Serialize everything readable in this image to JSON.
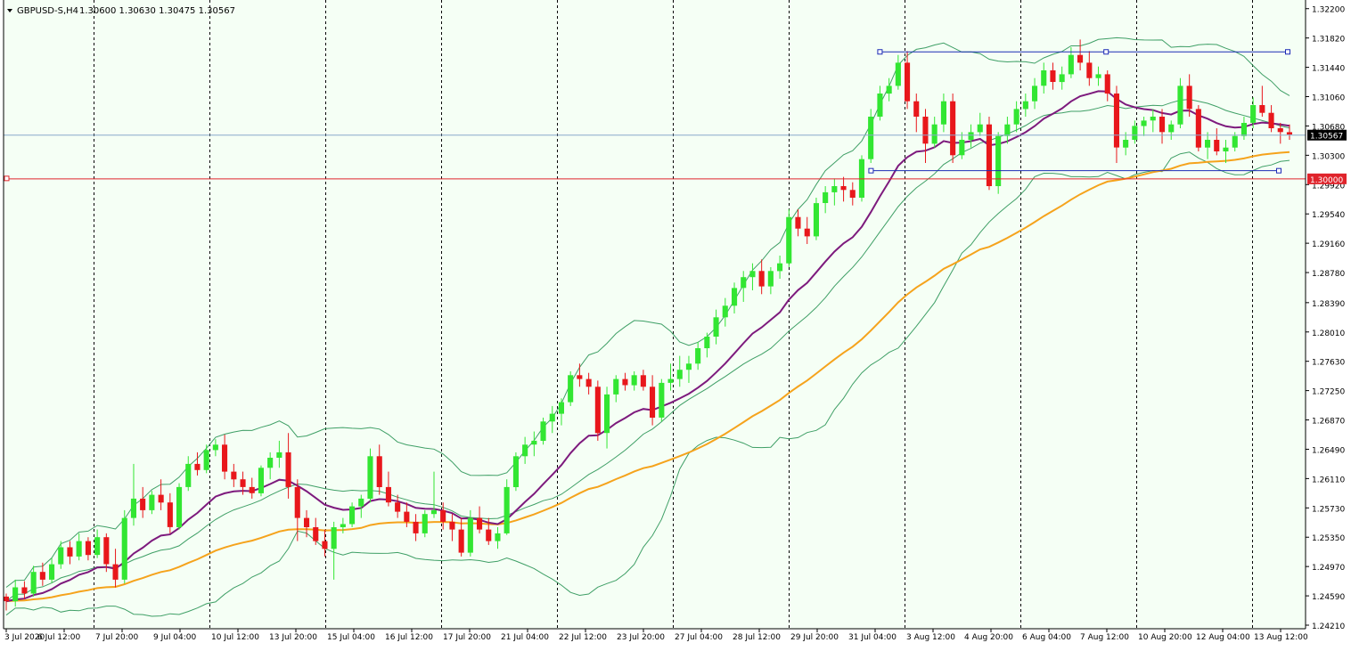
{
  "header": {
    "symbol": "GBPUSD-S,H4",
    "ohlc": "1.30600 1.30630 1.30475 1.30567"
  },
  "colors": {
    "background": "#f5fff5",
    "bull_candle": "#32e632",
    "bear_candle": "#e8171b",
    "ma_fast": "#7d1a7d",
    "ma_slow": "#f5a31c",
    "bollinger": "#3f9f66",
    "box_lines": "#1c2bb5",
    "level_line": "#e0242c",
    "current_price_line": "#8aa8cc"
  },
  "chart_data": {
    "type": "candlestick",
    "timeframe": "H4",
    "ylim": [
      1.2421,
      1.3222
    ],
    "price_axis_ticks": [
      "1.32200",
      "1.31820",
      "1.31440",
      "1.31060",
      "1.30680",
      "1.30300",
      "1.29920",
      "1.29540",
      "1.29160",
      "1.28780",
      "1.28390",
      "1.28010",
      "1.27630",
      "1.27250",
      "1.26870",
      "1.26490",
      "1.26110",
      "1.25730",
      "1.25350",
      "1.24970",
      "1.24590",
      "1.24210"
    ],
    "time_axis_labels": [
      "3 Jul 2020",
      "6 Jul 12:00",
      "7 Jul 20:00",
      "9 Jul 04:00",
      "10 Jul 12:00",
      "13 Jul 20:00",
      "15 Jul 04:00",
      "16 Jul 12:00",
      "17 Jul 20:00",
      "21 Jul 04:00",
      "22 Jul 12:00",
      "23 Jul 20:00",
      "27 Jul 04:00",
      "28 Jul 12:00",
      "29 Jul 20:00",
      "31 Jul 04:00",
      "3 Aug 12:00",
      "4 Aug 20:00",
      "6 Aug 04:00",
      "7 Aug 12:00",
      "10 Aug 20:00",
      "12 Aug 04:00",
      "13 Aug 12:00"
    ],
    "current_price_label": "1.30567",
    "level_label": "1.30000",
    "current_price": 1.30567,
    "level_price": 1.3,
    "range_box": {
      "high": 1.3164,
      "low": 1.301
    },
    "candles": [
      [
        1.2458,
        1.2462,
        1.244,
        1.2452
      ],
      [
        1.2452,
        1.248,
        1.2445,
        1.247
      ],
      [
        1.247,
        1.2478,
        1.2455,
        1.2462
      ],
      [
        1.2462,
        1.2498,
        1.2458,
        1.249
      ],
      [
        1.249,
        1.2502,
        1.2472,
        1.248
      ],
      [
        1.248,
        1.2508,
        1.2476,
        1.25
      ],
      [
        1.25,
        1.253,
        1.2494,
        1.2522
      ],
      [
        1.2522,
        1.253,
        1.25,
        1.251
      ],
      [
        1.251,
        1.254,
        1.2505,
        1.253
      ],
      [
        1.253,
        1.2535,
        1.2505,
        1.2512
      ],
      [
        1.2512,
        1.2545,
        1.2508,
        1.2535
      ],
      [
        1.2535,
        1.254,
        1.249,
        1.25
      ],
      [
        1.25,
        1.252,
        1.247,
        1.248
      ],
      [
        1.248,
        1.257,
        1.2475,
        1.256
      ],
      [
        1.256,
        1.263,
        1.255,
        1.2585
      ],
      [
        1.2585,
        1.26,
        1.256,
        1.257
      ],
      [
        1.257,
        1.2595,
        1.2565,
        1.259
      ],
      [
        1.259,
        1.261,
        1.257,
        1.258
      ],
      [
        1.258,
        1.2592,
        1.254,
        1.2548
      ],
      [
        1.2548,
        1.2605,
        1.2545,
        1.26
      ],
      [
        1.26,
        1.264,
        1.2595,
        1.263
      ],
      [
        1.263,
        1.2645,
        1.2615,
        1.2622
      ],
      [
        1.2622,
        1.2655,
        1.2618,
        1.2648
      ],
      [
        1.2648,
        1.2662,
        1.264,
        1.2655
      ],
      [
        1.2655,
        1.2668,
        1.261,
        1.262
      ],
      [
        1.262,
        1.263,
        1.26,
        1.261
      ],
      [
        1.261,
        1.262,
        1.259,
        1.26
      ],
      [
        1.26,
        1.2612,
        1.2585,
        1.2592
      ],
      [
        1.2592,
        1.2628,
        1.2588,
        1.2625
      ],
      [
        1.2625,
        1.2645,
        1.261,
        1.2638
      ],
      [
        1.2638,
        1.266,
        1.2625,
        1.2645
      ],
      [
        1.2645,
        1.267,
        1.2585,
        1.26
      ],
      [
        1.26,
        1.261,
        1.253,
        1.256
      ],
      [
        1.256,
        1.257,
        1.2535,
        1.2548
      ],
      [
        1.2548,
        1.256,
        1.2525,
        1.253
      ],
      [
        1.253,
        1.2545,
        1.251,
        1.252
      ],
      [
        1.252,
        1.2555,
        1.248,
        1.2548
      ],
      [
        1.2548,
        1.256,
        1.254,
        1.2552
      ],
      [
        1.2552,
        1.258,
        1.2548,
        1.2575
      ],
      [
        1.2575,
        1.259,
        1.256,
        1.2585
      ],
      [
        1.2585,
        1.265,
        1.258,
        1.264
      ],
      [
        1.264,
        1.2655,
        1.259,
        1.26
      ],
      [
        1.26,
        1.262,
        1.2575,
        1.258
      ],
      [
        1.258,
        1.259,
        1.256,
        1.2568
      ],
      [
        1.2568,
        1.258,
        1.2548,
        1.2555
      ],
      [
        1.2555,
        1.2565,
        1.253,
        1.254
      ],
      [
        1.254,
        1.257,
        1.2535,
        1.2565
      ],
      [
        1.2565,
        1.262,
        1.256,
        1.257
      ],
      [
        1.257,
        1.258,
        1.2545,
        1.2555
      ],
      [
        1.2555,
        1.2565,
        1.253,
        1.2545
      ],
      [
        1.2545,
        1.256,
        1.251,
        1.2515
      ],
      [
        1.2515,
        1.257,
        1.251,
        1.256
      ],
      [
        1.256,
        1.2575,
        1.254,
        1.2545
      ],
      [
        1.2545,
        1.256,
        1.2525,
        1.253
      ],
      [
        1.253,
        1.2548,
        1.252,
        1.254
      ],
      [
        1.254,
        1.261,
        1.2538,
        1.26
      ],
      [
        1.26,
        1.2645,
        1.2595,
        1.264
      ],
      [
        1.264,
        1.2665,
        1.263,
        1.2655
      ],
      [
        1.2655,
        1.2672,
        1.264,
        1.266
      ],
      [
        1.266,
        1.269,
        1.2655,
        1.2685
      ],
      [
        1.2685,
        1.2705,
        1.267,
        1.2695
      ],
      [
        1.2695,
        1.2715,
        1.268,
        1.271
      ],
      [
        1.271,
        1.275,
        1.2705,
        1.2745
      ],
      [
        1.2745,
        1.276,
        1.273,
        1.274
      ],
      [
        1.274,
        1.2748,
        1.272,
        1.273
      ],
      [
        1.273,
        1.2738,
        1.266,
        1.267
      ],
      [
        1.267,
        1.273,
        1.265,
        1.272
      ],
      [
        1.272,
        1.2745,
        1.271,
        1.274
      ],
      [
        1.274,
        1.2748,
        1.2725,
        1.2732
      ],
      [
        1.2732,
        1.275,
        1.2725,
        1.2745
      ],
      [
        1.2745,
        1.2752,
        1.2725,
        1.273
      ],
      [
        1.273,
        1.2745,
        1.268,
        1.269
      ],
      [
        1.269,
        1.274,
        1.2685,
        1.2735
      ],
      [
        1.2735,
        1.276,
        1.2725,
        1.274
      ],
      [
        1.274,
        1.277,
        1.273,
        1.2752
      ],
      [
        1.2752,
        1.277,
        1.2735,
        1.276
      ],
      [
        1.276,
        1.2788,
        1.2752,
        1.278
      ],
      [
        1.278,
        1.28,
        1.2768,
        1.2795
      ],
      [
        1.2795,
        1.283,
        1.2785,
        1.282
      ],
      [
        1.282,
        1.2845,
        1.2808,
        1.2835
      ],
      [
        1.2835,
        1.2865,
        1.2825,
        1.2858
      ],
      [
        1.2858,
        1.288,
        1.284,
        1.2872
      ],
      [
        1.2872,
        1.289,
        1.2855,
        1.288
      ],
      [
        1.288,
        1.2895,
        1.285,
        1.286
      ],
      [
        1.286,
        1.2885,
        1.285,
        1.288
      ],
      [
        1.288,
        1.29,
        1.287,
        1.289
      ],
      [
        1.289,
        1.296,
        1.2885,
        1.295
      ],
      [
        1.295,
        1.296,
        1.2925,
        1.2935
      ],
      [
        1.2935,
        1.295,
        1.2915,
        1.2925
      ],
      [
        1.2925,
        1.2975,
        1.292,
        1.2968
      ],
      [
        1.2968,
        1.299,
        1.2955,
        1.2982
      ],
      [
        1.2982,
        1.3,
        1.2965,
        1.299
      ],
      [
        1.299,
        1.3002,
        1.297,
        1.2985
      ],
      [
        1.2985,
        1.2995,
        1.2965,
        1.2975
      ],
      [
        1.2975,
        1.303,
        1.297,
        1.3025
      ],
      [
        1.3025,
        1.309,
        1.302,
        1.308
      ],
      [
        1.308,
        1.312,
        1.3075,
        1.311
      ],
      [
        1.311,
        1.313,
        1.31,
        1.312
      ],
      [
        1.312,
        1.316,
        1.3115,
        1.315
      ],
      [
        1.315,
        1.3165,
        1.309,
        1.31
      ],
      [
        1.31,
        1.311,
        1.306,
        1.308
      ],
      [
        1.308,
        1.309,
        1.302,
        1.3045
      ],
      [
        1.3045,
        1.308,
        1.304,
        1.307
      ],
      [
        1.307,
        1.311,
        1.306,
        1.31
      ],
      [
        1.31,
        1.311,
        1.302,
        1.303
      ],
      [
        1.303,
        1.306,
        1.3025,
        1.305
      ],
      [
        1.305,
        1.307,
        1.304,
        1.306
      ],
      [
        1.306,
        1.3085,
        1.3055,
        1.307
      ],
      [
        1.307,
        1.308,
        1.2985,
        1.299
      ],
      [
        1.299,
        1.306,
        1.298,
        1.3055
      ],
      [
        1.3055,
        1.308,
        1.3045,
        1.307
      ],
      [
        1.307,
        1.31,
        1.306,
        1.309
      ],
      [
        1.309,
        1.311,
        1.308,
        1.31
      ],
      [
        1.31,
        1.313,
        1.309,
        1.312
      ],
      [
        1.312,
        1.315,
        1.311,
        1.314
      ],
      [
        1.314,
        1.315,
        1.3115,
        1.3125
      ],
      [
        1.3125,
        1.3145,
        1.3115,
        1.3135
      ],
      [
        1.3135,
        1.317,
        1.313,
        1.316
      ],
      [
        1.316,
        1.318,
        1.314,
        1.315
      ],
      [
        1.315,
        1.3165,
        1.312,
        1.313
      ],
      [
        1.313,
        1.3145,
        1.312,
        1.3135
      ],
      [
        1.3135,
        1.314,
        1.31,
        1.311
      ],
      [
        1.311,
        1.312,
        1.302,
        1.304
      ],
      [
        1.304,
        1.306,
        1.303,
        1.305
      ],
      [
        1.305,
        1.3075,
        1.3045,
        1.3068
      ],
      [
        1.3068,
        1.308,
        1.3055,
        1.3075
      ],
      [
        1.3075,
        1.309,
        1.306,
        1.308
      ],
      [
        1.308,
        1.309,
        1.3045,
        1.306
      ],
      [
        1.306,
        1.3075,
        1.305,
        1.307
      ],
      [
        1.307,
        1.313,
        1.3065,
        1.312
      ],
      [
        1.312,
        1.3135,
        1.308,
        1.309
      ],
      [
        1.309,
        1.3095,
        1.3035,
        1.304
      ],
      [
        1.304,
        1.306,
        1.3025,
        1.305
      ],
      [
        1.305,
        1.3065,
        1.303,
        1.3035
      ],
      [
        1.3035,
        1.305,
        1.302,
        1.304
      ],
      [
        1.304,
        1.306,
        1.3035,
        1.3055
      ],
      [
        1.3055,
        1.308,
        1.305,
        1.3072
      ],
      [
        1.3072,
        1.3105,
        1.3065,
        1.3095
      ],
      [
        1.3095,
        1.312,
        1.308,
        1.3085
      ],
      [
        1.3085,
        1.3095,
        1.306,
        1.3065
      ],
      [
        1.3065,
        1.3072,
        1.3045,
        1.306
      ],
      [
        1.306,
        1.307,
        1.305,
        1.3057
      ]
    ]
  }
}
